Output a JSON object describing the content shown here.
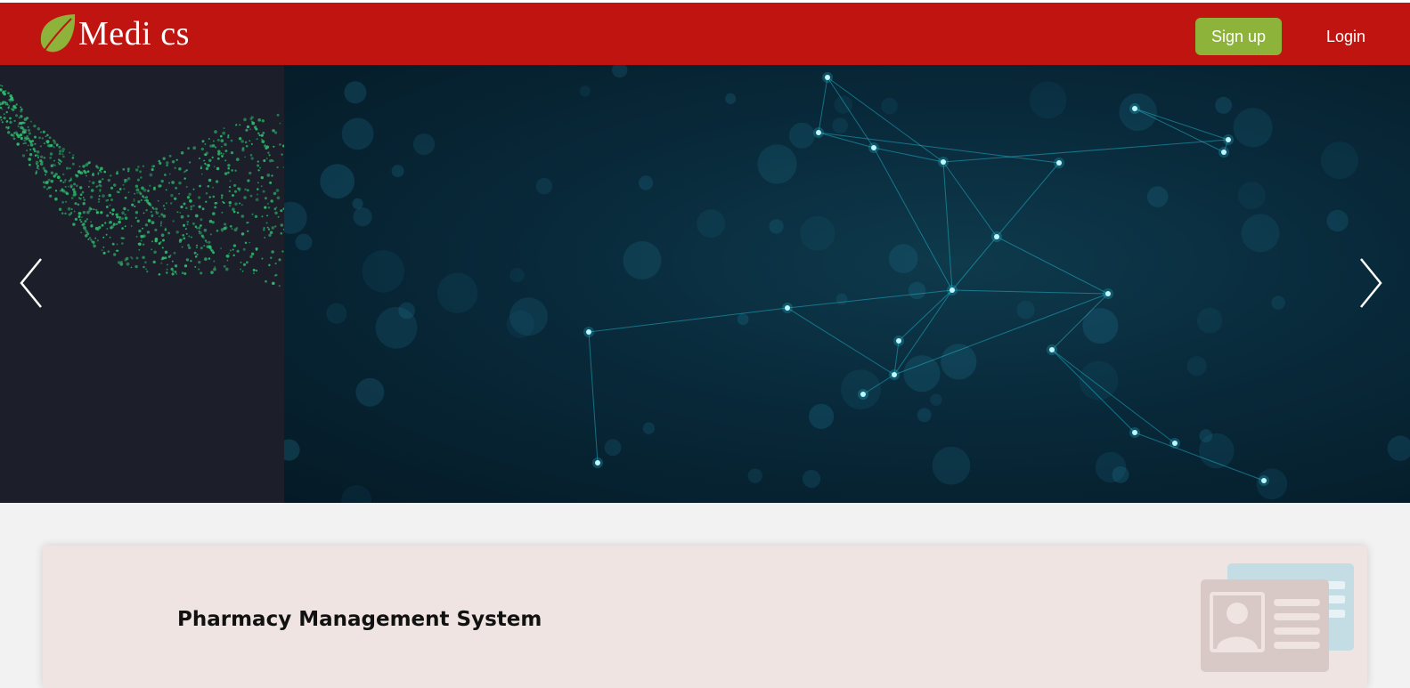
{
  "header": {
    "brand_text": "Medi cs",
    "brand_icon": "leaf-icon",
    "signup_label": "Sign up",
    "login_label": "Login",
    "colors": {
      "nav_bg": "#bf1410",
      "signup_bg": "#8db33a",
      "text": "#ffffff"
    }
  },
  "carousel": {
    "prev_icon": "chevron-left-icon",
    "next_icon": "chevron-right-icon",
    "slide_left_accent": "#2fbf6f",
    "slide_right_accent": "#22c9e0"
  },
  "card": {
    "title": "Pharmacy Management System",
    "illustration_icon": "id-card-icon",
    "bg": "#efe4e1"
  }
}
